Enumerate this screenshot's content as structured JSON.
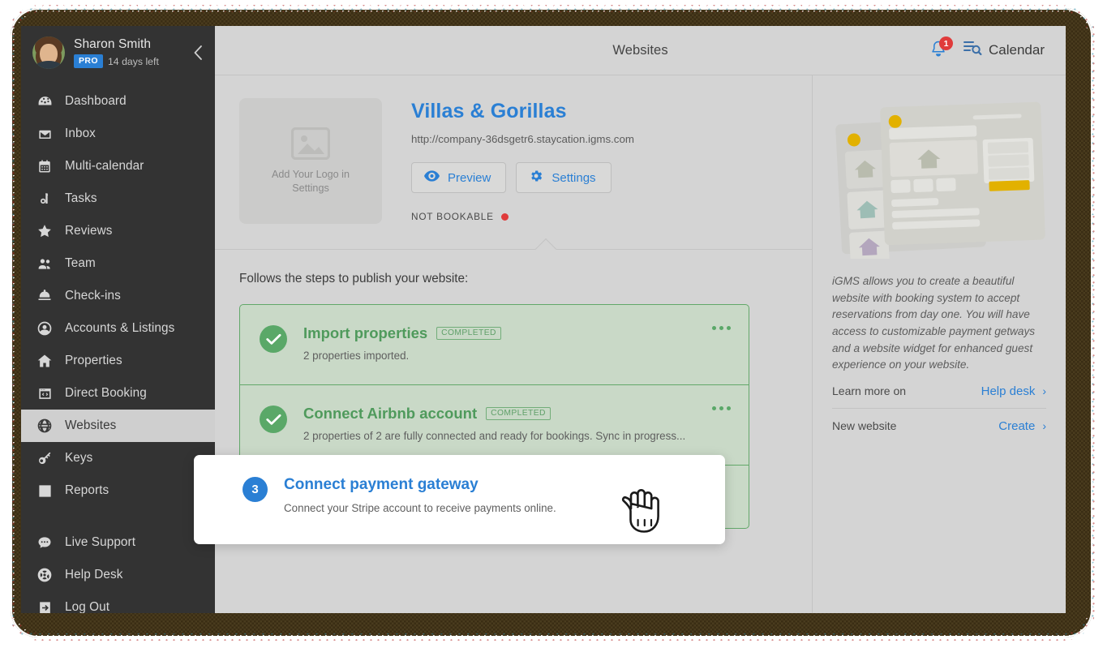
{
  "sidebar": {
    "user": {
      "name": "Sharon Smith",
      "plan_badge": "PRO",
      "trial_text": "14 days left",
      "collapse_icon": "chevron-left-icon",
      "avatar_alt": "user-avatar"
    },
    "items": [
      {
        "label": "Dashboard",
        "icon": "dashboard-icon",
        "active": false
      },
      {
        "label": "Inbox",
        "icon": "inbox-icon",
        "active": false
      },
      {
        "label": "Multi-calendar",
        "icon": "calendar-icon",
        "active": false
      },
      {
        "label": "Tasks",
        "icon": "tasks-icon",
        "active": false
      },
      {
        "label": "Reviews",
        "icon": "star-icon",
        "active": false
      },
      {
        "label": "Team",
        "icon": "team-icon",
        "active": false
      },
      {
        "label": "Check-ins",
        "icon": "bell-desk-icon",
        "active": false
      },
      {
        "label": "Accounts & Listings",
        "icon": "account-icon",
        "active": false
      },
      {
        "label": "Properties",
        "icon": "home-icon",
        "active": false
      },
      {
        "label": "Direct Booking",
        "icon": "code-window-icon",
        "active": false
      },
      {
        "label": "Websites",
        "icon": "globe-icon",
        "active": true
      },
      {
        "label": "Keys",
        "icon": "key-icon",
        "active": false
      },
      {
        "label": "Reports",
        "icon": "chart-bar-icon",
        "active": false
      }
    ],
    "footer_items": [
      {
        "label": "Live Support",
        "icon": "chat-icon"
      },
      {
        "label": "Help Desk",
        "icon": "lifebuoy-icon"
      },
      {
        "label": "Log Out",
        "icon": "logout-icon"
      }
    ]
  },
  "topbar": {
    "title": "Websites",
    "notification_icon": "bell-icon",
    "notification_count": "1",
    "calendar_icon": "calendar-search-icon",
    "calendar_label": "Calendar"
  },
  "site": {
    "logo_placeholder_icon": "image-placeholder-icon",
    "logo_placeholder_text": "Add Your Logo in Settings",
    "name": "Villas & Gorillas",
    "url": "http://company-36dsgetr6.staycation.igms.com",
    "preview_button": {
      "label": "Preview",
      "icon": "eye-icon"
    },
    "settings_button": {
      "label": "Settings",
      "icon": "gear-icon"
    },
    "status_label": "NOT BOOKABLE",
    "status_color": "#e03b3b"
  },
  "steps": {
    "heading": "Follows the steps to publish your website:",
    "items": [
      {
        "title": "Import properties",
        "tag": "COMPLETED",
        "desc": "2 properties imported.",
        "state": "completed",
        "menu_icon": "ellipsis-icon"
      },
      {
        "title": "Connect Airbnb account",
        "tag": "COMPLETED",
        "desc": "2 properties of 2 are fully connected and ready for bookings. Sync in progress...",
        "state": "completed",
        "menu_icon": "ellipsis-icon"
      }
    ],
    "highlighted": {
      "number": "3",
      "title": "Connect payment gateway",
      "desc": "Connect your Stripe account to receive payments online.",
      "cursor_icon": "hand-pointer-cursor"
    }
  },
  "right_panel": {
    "illustration_alt": "website-builder-illustration",
    "description": "iGMS allows you to create a beautiful website with booking system to accept reservations from day one. You will have access to customizable payment getways and a website widget for enhanced guest experience on your website.",
    "links": [
      {
        "label": "Learn more on",
        "action": "Help desk",
        "chevron": "chevron-right-icon"
      },
      {
        "label": "New website",
        "action": "Create",
        "chevron": "chevron-right-icon"
      }
    ]
  },
  "theme": {
    "accent_blue": "#2a7fd4",
    "green": "#5aa868",
    "green_bg": "#c9d9c7",
    "red": "#e03b3b",
    "sidebar_bg": "#333333",
    "canvas_bg": "#d4d4d4"
  }
}
